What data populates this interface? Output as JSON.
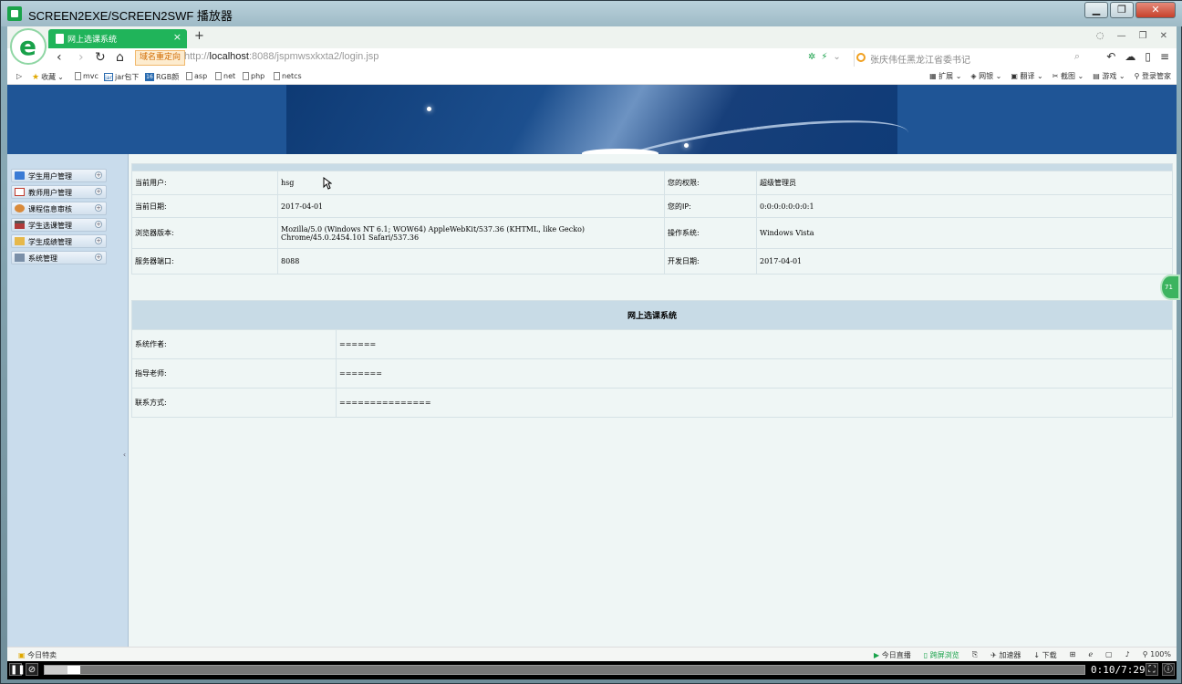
{
  "player": {
    "title": "SCREEN2EXE/SCREEN2SWF 播放器",
    "time": "0:10/7:29",
    "progress_fraction": 0.022
  },
  "browser": {
    "tab_label": "网上选课系统",
    "redirect_label": "域名重定向",
    "url_prefix": "http://",
    "url_host": "localhost",
    "url_rest": ":8088/jspmwsxkxta2/login.jsp",
    "search_placeholder": "张庆伟任黑龙江省委书记",
    "bookmarks": {
      "favorites": "收藏",
      "mvc": "mvc",
      "jar": "jar包下",
      "rgb": "RGB颜",
      "asp": "asp",
      "net": "net",
      "php": "php",
      "netcs": "netcs"
    },
    "bm_right": {
      "ext": "扩展",
      "bank": "网银",
      "translate": "翻译",
      "screenshot": "截图",
      "game": "游戏",
      "login": "登录管家"
    },
    "status": {
      "today": "今日特卖",
      "live": "今日直播",
      "fullscreen": "跨屏浏览",
      "accelerator": "加速器",
      "download": "下载",
      "zoom": "100%"
    }
  },
  "sidebar": {
    "items": [
      {
        "label": "学生用户管理"
      },
      {
        "label": "教师用户管理"
      },
      {
        "label": "课程信息审核"
      },
      {
        "label": "学生选课管理"
      },
      {
        "label": "学生成绩管理"
      },
      {
        "label": "系统管理"
      }
    ]
  },
  "info": {
    "rows": [
      {
        "l1": "当前用户:",
        "v1": "hsg",
        "l2": "您的权限:",
        "v2": "超级管理员"
      },
      {
        "l1": "当前日期:",
        "v1": "2017-04-01",
        "l2": "您的IP:",
        "v2": "0:0:0:0:0:0:0:1"
      },
      {
        "l1": "浏览器版本:",
        "v1": "Mozilla/5.0 (Windows NT 6.1; WOW64) AppleWebKit/537.36 (KHTML, like Gecko) Chrome/45.0.2454.101 Safari/537.36",
        "l2": "操作系统:",
        "v2": "Windows Vista"
      },
      {
        "l1": "服务器端口:",
        "v1": "8088",
        "l2": "开发日期:",
        "v2": "2017-04-01"
      }
    ]
  },
  "about": {
    "title": "网上选课系统",
    "rows": [
      {
        "label": "系统作者:",
        "value": "======"
      },
      {
        "label": "指导老师:",
        "value": "======="
      },
      {
        "label": "联系方式:",
        "value": "==============="
      }
    ]
  },
  "side_badge": "71",
  "colors": {
    "banner": "#1f5596",
    "sidebar": "#c9dcec",
    "accent_green": "#20b45a",
    "table_header": "#c8dbe6"
  }
}
